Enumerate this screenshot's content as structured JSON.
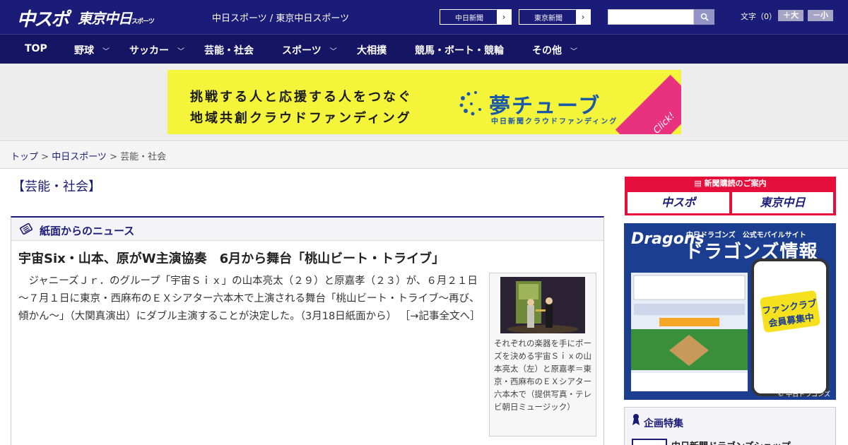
{
  "header": {
    "logo_chuspo": "中スポ",
    "logo_tokyo": "東京中日",
    "logo_tokyo_small": "スポーツ",
    "title": "中日スポーツ / 東京中日スポーツ",
    "links": [
      {
        "label": "中日新聞",
        "arrow": "›"
      },
      {
        "label": "東京新聞",
        "arrow": "›"
      }
    ],
    "search_placeholder": "",
    "fontsize_label": "文字（0）",
    "fontsize_up": "＋大",
    "fontsize_down": "－小"
  },
  "nav": [
    {
      "label": "TOP",
      "dropdown": false
    },
    {
      "label": "野球",
      "dropdown": true
    },
    {
      "label": "サッカー",
      "dropdown": true
    },
    {
      "label": "芸能・社会",
      "dropdown": false
    },
    {
      "label": "スポーツ",
      "dropdown": true
    },
    {
      "label": "大相撲",
      "dropdown": false
    },
    {
      "label": "競馬・ボート・競輪",
      "dropdown": false
    },
    {
      "label": "その他",
      "dropdown": true
    }
  ],
  "banner": {
    "line1": "挑戦する人と応援する人をつなぐ",
    "line2": "地域共創クラウドファンディング",
    "logo": "夢チューブ",
    "sub": "中日新聞クラウドファンディング",
    "click": "Click!"
  },
  "breadcrumb": {
    "top": "トップ",
    "sep1": " > ",
    "parent": "中日スポーツ",
    "sep2": " > ",
    "current": "芸能・社会"
  },
  "section_title": "【芸能・社会】",
  "news_box": {
    "header": "紙面からのニュース",
    "article_title": "宇宙Six・山本、原がW主演協奏　6月から舞台「桃山ビート・トライブ」",
    "article_body": "　ジャニーズＪｒ．のグループ「宇宙Ｓｉｘ」の山本亮太（２９）と原嘉孝（２３）が、６月２１日～７月１日に東京・西麻布のＥＸシアター六本木で上演される舞台「桃山ビート・トライブ～再び、傾かん～」（大関真演出）にダブル主演することが決定した。（3月18日紙面から）",
    "more": "［→記事全文へ］",
    "photo_caption": "それぞれの楽器を手にポーズを決める宇宙Ｓｉｘの山本亮太（左）と原嘉孝＝東京・西麻布のＥＸシアター六本木で（提供写真・テレビ朝日ミュージック）"
  },
  "sidebar": {
    "subscribe_header": "新聞購読のご案内",
    "subscribe_logo1": "中スポ",
    "subscribe_logo2": "東京中日",
    "dragons_logo": "Dragons",
    "dragons_sub": "中日ドラゴンズ　公式モバイルサイト",
    "dragons_big": "ドラゴンズ情報",
    "dragons_badge": "ファンクラブ会員募集中",
    "dragons_copy": "© 中日ドラゴンズ",
    "kikaku_title": "企画特集",
    "kikaku_item": "中日新聞ドラゴンズショップ"
  }
}
